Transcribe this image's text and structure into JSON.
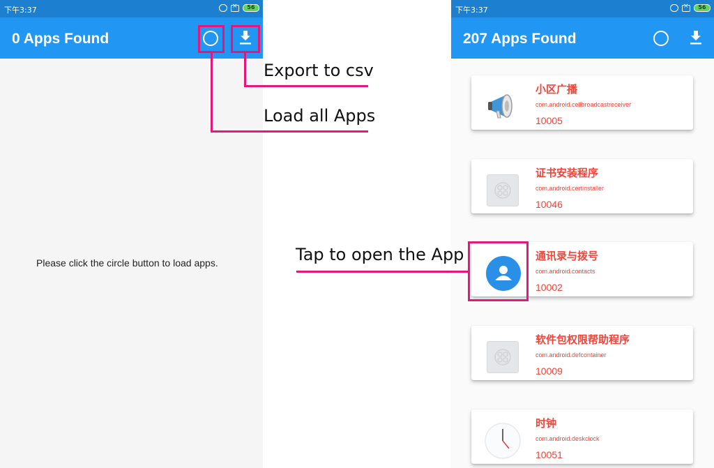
{
  "left_screen": {
    "status_time": "下午3:37",
    "battery": "56",
    "title": "0 Apps Found",
    "empty_message": "Please click the circle button to load apps."
  },
  "right_screen": {
    "status_time": "下午3:37",
    "battery": "56",
    "title": "207 Apps Found",
    "apps": [
      {
        "name": "小区广播",
        "package": "com.android.cellbroadcastreceiver",
        "uid": "10005",
        "icon": "megaphone-icon"
      },
      {
        "name": "证书安装程序",
        "package": "com.android.certinstaller",
        "uid": "10046",
        "icon": "default-app-icon"
      },
      {
        "name": "通讯录与拨号",
        "package": "com.android.contacts",
        "uid": "10002",
        "icon": "contacts-icon"
      },
      {
        "name": "软件包权限帮助程序",
        "package": "com.android.defcontainer",
        "uid": "10009",
        "icon": "default-app-icon"
      },
      {
        "name": "时钟",
        "package": "com.android.deskclock",
        "uid": "10051",
        "icon": "clock-icon"
      }
    ]
  },
  "annotations": {
    "export": "Export to csv",
    "load": "Load all Apps",
    "tap": "Tap to open the App"
  },
  "colors": {
    "appbar": "#2196f3",
    "statusbar": "#1c7fd0",
    "highlight": "#e6177a",
    "app_text": "#f44336"
  }
}
